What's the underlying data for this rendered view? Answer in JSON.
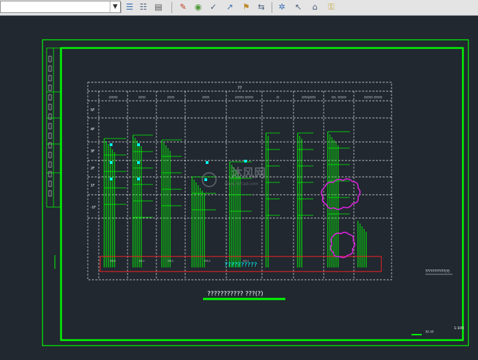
{
  "toolbar": {
    "combo_value": "",
    "buttons": [
      {
        "name": "layer-stack-icon",
        "glyph": "☰",
        "color": "#3a6fb5"
      },
      {
        "name": "layer-list-icon",
        "glyph": "☷",
        "color": "#4a5f7a"
      },
      {
        "name": "layer-states-icon",
        "glyph": "▤",
        "color": "#555555"
      },
      {
        "name": "layer-off-icon",
        "glyph": "✎",
        "color": "#c0482c"
      },
      {
        "name": "layer-isolate-icon",
        "glyph": "◉",
        "color": "#4f9a3a"
      },
      {
        "name": "layer-freeze-icon",
        "glyph": "✓",
        "color": "#4a5f7a"
      },
      {
        "name": "layer-lock-icon",
        "glyph": "↗",
        "color": "#3a6fb5"
      },
      {
        "name": "layer-match-icon",
        "glyph": "⚑",
        "color": "#c08a2c"
      },
      {
        "name": "layer-walk-icon",
        "glyph": "⇆",
        "color": "#4a5f7a"
      },
      {
        "name": "sun-settings-icon",
        "glyph": "✲",
        "color": "#3a6fb5"
      },
      {
        "name": "light-point-icon",
        "glyph": "↖",
        "color": "#4a5f7a"
      },
      {
        "name": "light-spot-icon",
        "glyph": "⌂",
        "color": "#4a5f7a"
      },
      {
        "name": "render-lock-icon",
        "glyph": "⚿",
        "color": "#c0a020"
      }
    ]
  },
  "drawing": {
    "section_header": "??",
    "column_headers": [
      "??????",
      "?????",
      "?????",
      "?????",
      "?????? ??????",
      "??",
      "?????/????",
      "???. ??????",
      "?????? ??????"
    ],
    "floor_labels": [
      "5F",
      "4F",
      "3F",
      "2F",
      "1F",
      "-1F"
    ],
    "riser_tags": [
      "???-?",
      "???-?",
      "???-?",
      "???-?",
      "???-?"
    ],
    "source_box_label": "??????????",
    "title": "??????????? ???(?)",
    "note": "???????????(?)",
    "scale": "1:100",
    "sheet_code": "??-??",
    "watermark": "沐风网",
    "watermark_url": "www.mfcad.com",
    "colors": {
      "background": "#212830",
      "frame": "#00ff00",
      "grid": "#f0f0f0",
      "riser": "#00ff00",
      "label": "#00ffff",
      "callout": "#dd22dd",
      "source_box": "#ff2020",
      "text_white": "#ffffff"
    }
  }
}
